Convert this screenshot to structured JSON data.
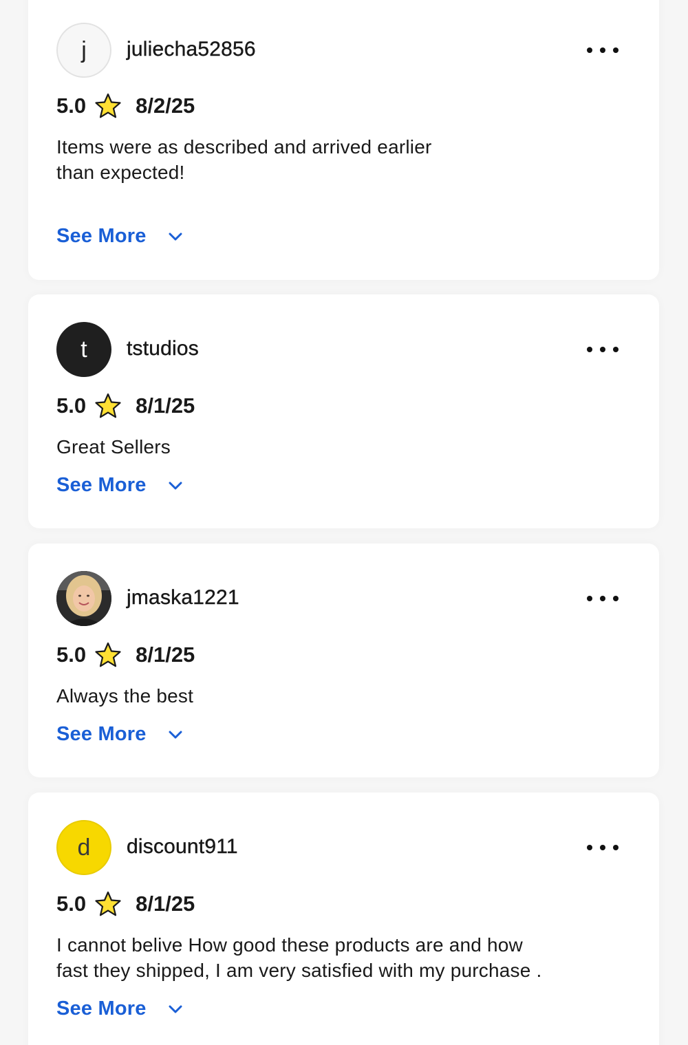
{
  "reviews": [
    {
      "username": "juliecha52856",
      "avatar_letter": "j",
      "avatar_style": "light",
      "score": "5.0",
      "date": "8/2/25",
      "text_lines": [
        "Items were as described and arrived earlier",
        "than expected!"
      ],
      "see_more_label": "See More"
    },
    {
      "username": "tstudios",
      "avatar_letter": "t",
      "avatar_style": "dark",
      "score": "5.0",
      "date": "8/1/25",
      "text_lines": [
        "Great Sellers"
      ],
      "see_more_label": "See More"
    },
    {
      "username": "jmaska1221",
      "avatar_letter": "",
      "avatar_style": "photo",
      "score": "5.0",
      "date": "8/1/25",
      "text_lines": [
        "Always the best"
      ],
      "see_more_label": "See More"
    },
    {
      "username": "discount911",
      "avatar_letter": "d",
      "avatar_style": "yellow",
      "score": "5.0",
      "date": "8/1/25",
      "text_lines": [
        "I cannot belive How good these products are and how",
        "fast they shipped, I am very satisfied with my purchase ."
      ],
      "see_more_label": "See More"
    }
  ],
  "colors": {
    "link": "#1a5fd6",
    "star_fill": "#ffe033",
    "star_stroke": "#1a1a1a",
    "yellow_avatar": "#f7d800"
  },
  "icons": {
    "rating": "star-icon",
    "menu": "more-options-icon",
    "expand": "chevron-down-icon"
  }
}
